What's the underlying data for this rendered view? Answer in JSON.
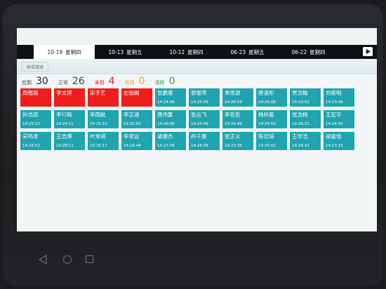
{
  "tabs": [
    {
      "date": "10-19",
      "weekday": "星期四",
      "active": true
    },
    {
      "date": "10-13",
      "weekday": "星期五",
      "active": false
    },
    {
      "date": "10-12",
      "weekday": "星期四",
      "active": false
    },
    {
      "date": "06-23",
      "weekday": "星期五",
      "active": false
    },
    {
      "date": "06-22",
      "weekday": "星期四",
      "active": false
    }
  ],
  "class_tab": "桥梁双班",
  "stats": {
    "due_label": "应到",
    "due_value": "30",
    "normal_label": "正常",
    "normal_value": "26",
    "absent_label": "未到",
    "absent_value": "4",
    "late_label": "迟到",
    "late_value": "0",
    "leave_label": "请假",
    "leave_value": "0"
  },
  "colors": {
    "absent": "#ef1d1d",
    "present": "#1fa4b0",
    "absent_stat": "#e31b1b",
    "late_stat": "#e6a317",
    "leave_stat": "#2ea14a"
  },
  "students": [
    {
      "name": "周楷璐",
      "time": "",
      "status": "absent"
    },
    {
      "name": "李文博",
      "time": "",
      "status": "absent"
    },
    {
      "name": "宋子艺",
      "time": "",
      "status": "absent"
    },
    {
      "name": "史珈阁",
      "time": "",
      "status": "absent"
    },
    {
      "name": "张鹏睿",
      "time": "14:24:56",
      "status": "present"
    },
    {
      "name": "郭俊萍",
      "time": "14:25:09",
      "status": "present"
    },
    {
      "name": "单思源",
      "time": "14:26:59",
      "status": "present"
    },
    {
      "name": "唐语彤",
      "time": "14:26:08",
      "status": "present"
    },
    {
      "name": "贾汶翰",
      "time": "14:23:52",
      "status": "present"
    },
    {
      "name": "刘希明",
      "time": "14:23:46",
      "status": "present"
    },
    {
      "name": "孙浩琼",
      "time": "14:25:13",
      "status": "present"
    },
    {
      "name": "李行简",
      "time": "14:24:11",
      "status": "present"
    },
    {
      "name": "李雨航",
      "time": "14:25:10",
      "status": "present"
    },
    {
      "name": "李芷涵",
      "time": "14:25:02",
      "status": "present"
    },
    {
      "name": "唐伟繁",
      "time": "14:26:06",
      "status": "present"
    },
    {
      "name": "张云飞",
      "time": "14:24:49",
      "status": "present"
    },
    {
      "name": "李哲哲",
      "time": "14:24:49",
      "status": "present"
    },
    {
      "name": "杨梓盈",
      "time": "14:24:59",
      "status": "present"
    },
    {
      "name": "张浩杨",
      "time": "14:26:21",
      "status": "present"
    },
    {
      "name": "王宏宇",
      "time": "14:24:45",
      "status": "present"
    },
    {
      "name": "宋鸣泽",
      "time": "14:24:52",
      "status": "present"
    },
    {
      "name": "王浩博",
      "time": "14:28:11",
      "status": "present"
    },
    {
      "name": "叶常祺",
      "time": "14:25:17",
      "status": "present"
    },
    {
      "name": "李思远",
      "time": "14:24:44",
      "status": "present"
    },
    {
      "name": "梁婕杰",
      "time": "14:27:06",
      "status": "present"
    },
    {
      "name": "孙千惠",
      "time": "14:25:08",
      "status": "present"
    },
    {
      "name": "张正义",
      "time": "14:23:36",
      "status": "present"
    },
    {
      "name": "陈佳琦",
      "time": "14:25:42",
      "status": "present"
    },
    {
      "name": "王学浩",
      "time": "14:24:47",
      "status": "present"
    },
    {
      "name": "胡嘉恬",
      "time": "14:23:15",
      "status": "present"
    }
  ]
}
